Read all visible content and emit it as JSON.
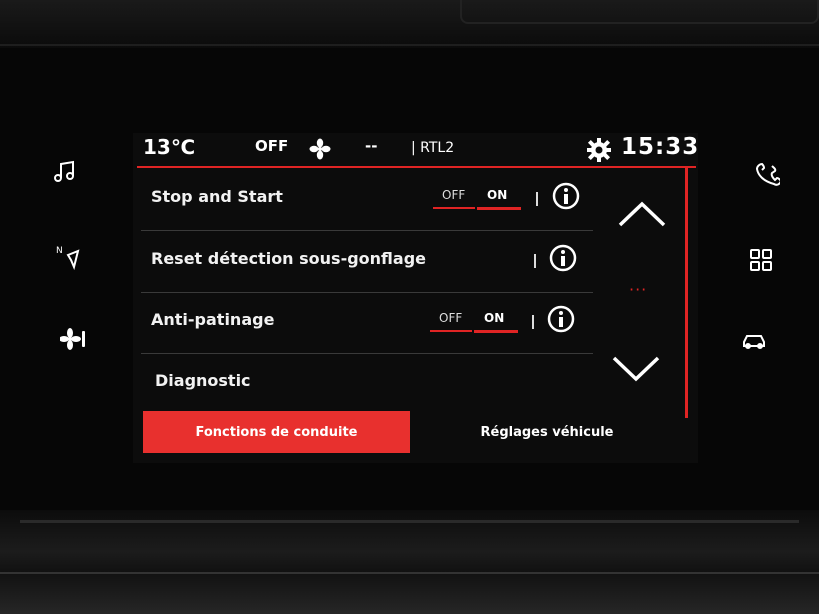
{
  "status_bar": {
    "temperature": "13℃",
    "fan_state": "OFF",
    "fan_icon": "fan-icon",
    "fan_level": "--",
    "radio_station": "| RTL2",
    "settings_icon": "gear-icon",
    "clock": "15:33"
  },
  "settings": [
    {
      "label": "Stop and Start",
      "toggle": {
        "off": "OFF",
        "on": "ON",
        "state": "ON"
      },
      "info_icon": "info-icon"
    },
    {
      "label": "Reset détection sous-gonflage",
      "info_icon": "info-icon"
    },
    {
      "label": "Anti-patinage",
      "toggle": {
        "off": "OFF",
        "on": "ON",
        "state": "ON"
      },
      "info_icon": "info-icon"
    },
    {
      "label": "Diagnostic"
    }
  ],
  "scroll": {
    "up_icon": "chevron-up-icon",
    "page_indicator": "···",
    "down_icon": "chevron-down-icon"
  },
  "tabs": [
    {
      "label": "Fonctions de conduite",
      "active": true
    },
    {
      "label": "Réglages véhicule",
      "active": false
    }
  ],
  "side_buttons_left": [
    "music-note-icon",
    "navigation-icon",
    "climate-fan-icon"
  ],
  "side_buttons_right": [
    "phone-icon",
    "apps-grid-icon",
    "car-icon"
  ],
  "colors": {
    "accent": "#e02424",
    "tab_active": "#e8302e",
    "background": "#0c0c0c"
  }
}
